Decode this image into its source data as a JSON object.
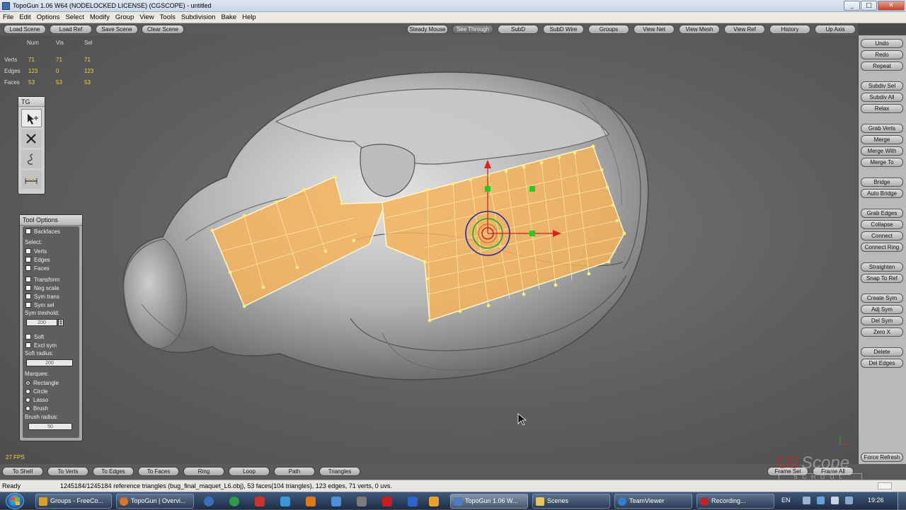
{
  "window": {
    "title": "TopoGun 1.06 W64  (NODELOCKED LICENSE) (CGSCOPE) - untitled",
    "controls": [
      "_",
      "□",
      "✕"
    ]
  },
  "menu": [
    "File",
    "Edit",
    "Options",
    "Select",
    "Modify",
    "Group",
    "View",
    "Tools",
    "Subdivision",
    "Bake",
    "Help"
  ],
  "toolbar": {
    "buttons": [
      {
        "label": "Load Scene",
        "active": false
      },
      {
        "label": "Load Ref",
        "active": false
      },
      {
        "label": "Save Scene",
        "active": false
      },
      {
        "label": "Clear Scene",
        "active": false
      },
      {
        "label": "Steady Mouse",
        "active": false
      },
      {
        "label": "See Through",
        "active": true
      },
      {
        "label": "SubD",
        "active": false
      },
      {
        "label": "SubD Wire",
        "active": false
      },
      {
        "label": "Groups",
        "active": false
      },
      {
        "label": "View Net",
        "active": false
      },
      {
        "label": "View Mesh",
        "active": false
      },
      {
        "label": "View Ref",
        "active": false
      },
      {
        "label": "History",
        "active": false
      },
      {
        "label": "Up Axis",
        "active": false
      }
    ]
  },
  "stats": {
    "headers": [
      "Num",
      "Vis",
      "Sel"
    ],
    "rows": [
      {
        "label": "Verts",
        "num": "71",
        "vis": "71",
        "sel": "71"
      },
      {
        "label": "Edges",
        "num": "123",
        "vis": "0",
        "sel": "123"
      },
      {
        "label": "Faces",
        "num": "53",
        "vis": "53",
        "sel": "53"
      }
    ],
    "fps": "27 FPS"
  },
  "tg_palette": {
    "title": "TG",
    "tools": [
      "select-move-icon",
      "cross-icon",
      "curve-draw-icon",
      "measure-icon"
    ]
  },
  "tool_options": {
    "title": "Tool Options",
    "backfaces": "Backfaces",
    "select_label": "Select:",
    "select_items": [
      "Verts",
      "Edges",
      "Faces"
    ],
    "toggles": [
      "Transform",
      "Neg scale",
      "Sym trans",
      "Sym sel"
    ],
    "sym_threshold_label": "Sym treshold:",
    "sym_threshold_value": "200",
    "soft": "Soft",
    "excl_sym": "Excl sym",
    "soft_radius_label": "Soft radius:",
    "soft_radius_value": "200",
    "marquee_label": "Marquee:",
    "marquee_items": [
      {
        "label": "Rectangle",
        "checked": true
      },
      {
        "label": "Circle",
        "checked": false
      },
      {
        "label": "Lasso",
        "checked": false
      },
      {
        "label": "Brush",
        "checked": false
      }
    ],
    "brush_radius_label": "Brush radius:",
    "brush_radius_value": "50"
  },
  "right_panel": {
    "buttons": [
      "Undo",
      "Redo",
      "Repeat",
      "Subdiv Sel",
      "Subdiv All",
      "Relax",
      "Grab Verts",
      "Merge",
      "Merge With",
      "Merge To",
      "Bridge",
      "Auto Bridge",
      "Grab Edges",
      "Collapse",
      "Connect",
      "Connect Ring",
      "Straighten",
      "Snap To Ref",
      "Create Sym",
      "Adj Sym",
      "Del Sym",
      "Zero X",
      "Delete",
      "Del Edges",
      "Force Refresh"
    ]
  },
  "bottom_toolbar": {
    "buttons": [
      "To Shell",
      "To Verts",
      "To Edges",
      "To Faces",
      "Ring",
      "Loop",
      "Path",
      "Triangles",
      "Frame Sel",
      "Frame All"
    ]
  },
  "watermark": {
    "cg": "CG",
    "scope": "Scope",
    "school": "SCHOOL"
  },
  "status": {
    "ready": "Ready",
    "message": "1245184/1245184 reference triangles (bug_final_maquet_L6.obj), 53 faces(104 triangles), 123 edges, 71 verts, 0 uvs."
  },
  "taskbar": {
    "tasks": [
      {
        "label": "Groups - FreeCo...",
        "icon_color": "#d7a12c",
        "active": false
      },
      {
        "label": "TopoGun | Overvi...",
        "icon_color": "#e2741f",
        "active": false
      },
      {
        "label": "TopoGun 1.06 W...",
        "icon_color": "#4c7cc0",
        "active": true
      },
      {
        "label": "Scenes",
        "icon_color": "#e8c45a",
        "active": false
      },
      {
        "label": "TeamViewer",
        "icon_color": "#2f7fd6",
        "active": false
      },
      {
        "label": "Recording...",
        "icon_color": "#c22525",
        "active": false
      }
    ],
    "lang": "EN",
    "clock": "19:26",
    "colors": {
      "accent": "#1d2e45",
      "mesh_fill": "#f5b25c",
      "vertex": "#f4f07a"
    }
  }
}
